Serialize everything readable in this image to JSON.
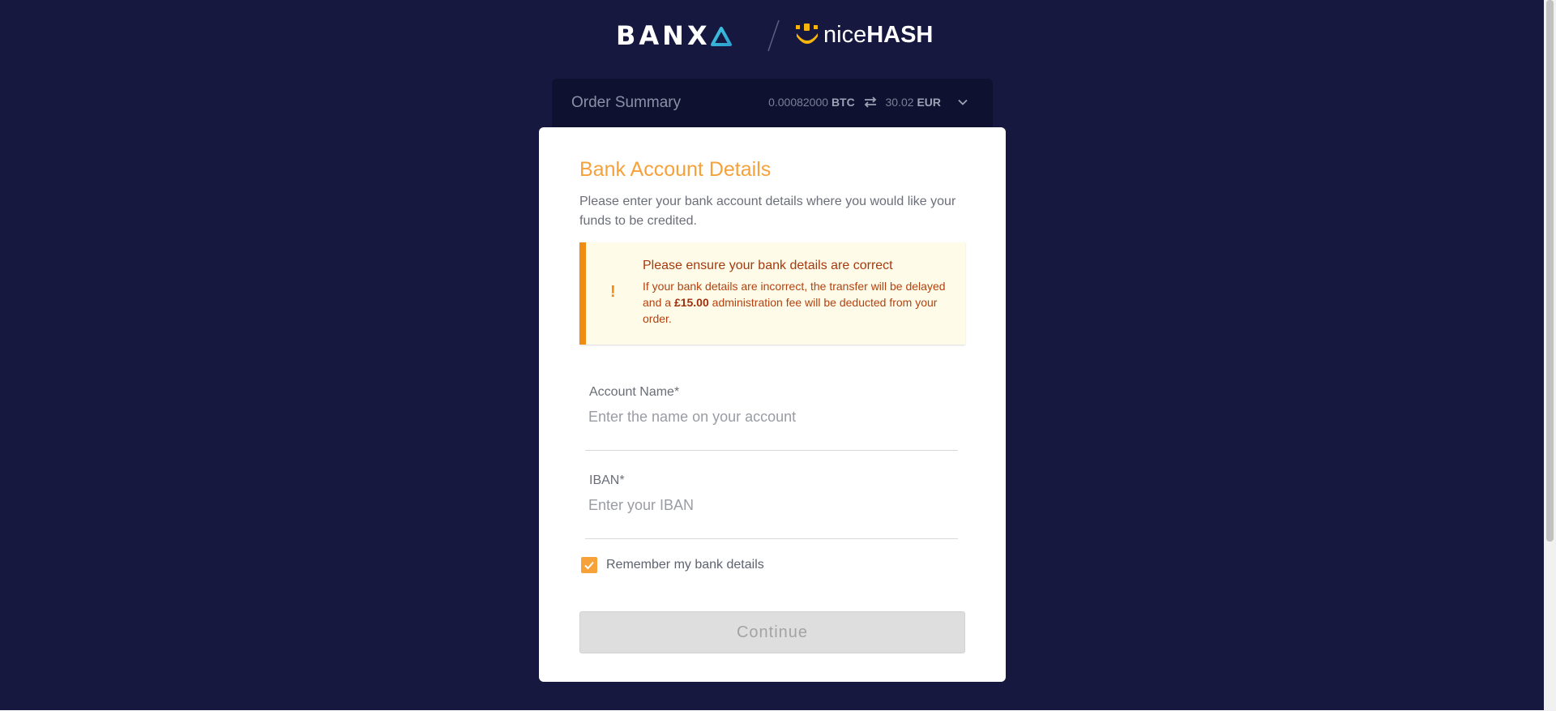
{
  "header": {
    "banxa_logo_text": "BANX",
    "nicehash_thin": "nice",
    "nicehash_bold": "HASH"
  },
  "order_summary": {
    "title": "Order Summary",
    "crypto_amount": "0.00082000",
    "crypto_currency": "BTC",
    "fiat_amount": "30.02",
    "fiat_currency": "EUR"
  },
  "card": {
    "title": "Bank Account Details",
    "subtitle": "Please enter your bank account details where you would like your funds to be credited.",
    "warning": {
      "icon": "!",
      "title": "Please ensure your bank details are correct",
      "body_pre": "If your bank details are incorrect, the transfer will be delayed and a ",
      "fee": "£15.00",
      "body_post": " administration fee will be deducted from your order."
    },
    "account_name": {
      "label": "Account Name*",
      "value": "",
      "placeholder": "Enter the name on your account"
    },
    "iban": {
      "label": "IBAN*",
      "value": "",
      "placeholder": "Enter your IBAN"
    },
    "remember": {
      "label": "Remember my bank details",
      "checked": true
    },
    "continue_label": "Continue"
  },
  "colors": {
    "background": "#161840",
    "accent": "#f7a13a",
    "warning_border": "#f08c12",
    "button_disabled": "#dedede"
  }
}
